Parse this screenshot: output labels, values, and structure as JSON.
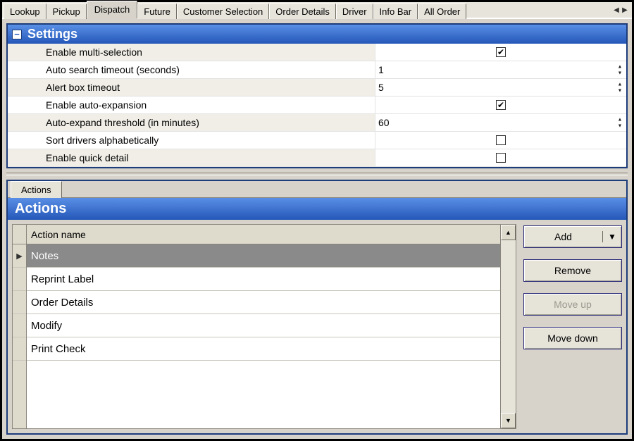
{
  "tabs": [
    "Lookup",
    "Pickup",
    "Dispatch",
    "Future",
    "Customer Selection",
    "Order Details",
    "Driver",
    "Info Bar",
    "All Order"
  ],
  "active_tab_index": 2,
  "settings_header": "Settings",
  "settings": {
    "rows": [
      {
        "label": "Enable multi-selection",
        "type": "check",
        "value": true,
        "alt": true
      },
      {
        "label": "Auto search timeout (seconds)",
        "type": "spin",
        "value": "1",
        "alt": false
      },
      {
        "label": "Alert box timeout",
        "type": "spin",
        "value": "5",
        "alt": true
      },
      {
        "label": "Enable auto-expansion",
        "type": "check",
        "value": true,
        "alt": false
      },
      {
        "label": "Auto-expand threshold (in minutes)",
        "type": "spin",
        "value": "60",
        "alt": true
      },
      {
        "label": "Sort drivers alphabetically",
        "type": "check",
        "value": false,
        "alt": false
      },
      {
        "label": "Enable quick detail",
        "type": "check",
        "value": false,
        "alt": true
      }
    ]
  },
  "lower_tab": "Actions",
  "lower_header": "Actions",
  "grid": {
    "column_header": "Action name",
    "rows": [
      "Notes",
      "Reprint Label",
      "Order Details",
      "Modify",
      "Print Check"
    ],
    "selected_index": 0
  },
  "buttons": {
    "add": "Add",
    "remove": "Remove",
    "moveup": "Move up",
    "movedown": "Move down"
  }
}
